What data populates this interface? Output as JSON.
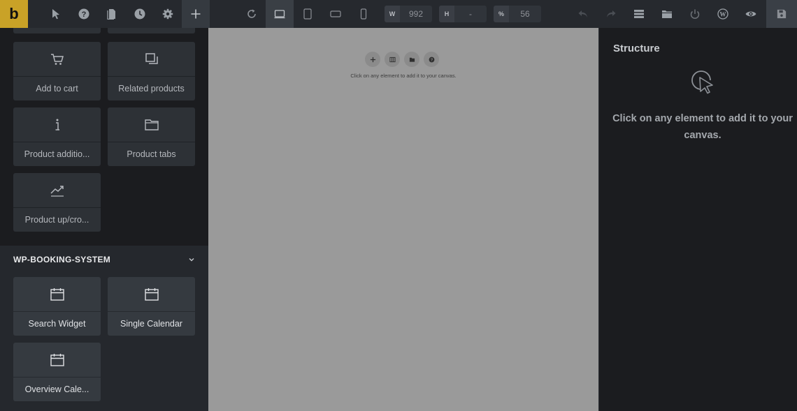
{
  "toolbar": {
    "logo": "b",
    "icons": [
      "cursor-icon",
      "help-icon",
      "pages-icon",
      "history-icon",
      "settings-icon",
      "add-icon",
      "refresh-icon",
      "desktop-icon",
      "tablet-portrait-icon",
      "tablet-landscape-icon",
      "mobile-icon",
      "undo-icon",
      "redo-icon",
      "layers-icon",
      "templates-icon",
      "power-icon",
      "wordpress-icon",
      "preview-icon",
      "save-icon"
    ],
    "width_label": "W",
    "width_value": "992",
    "height_label": "H",
    "height_value": "-",
    "zoom_label": "%",
    "zoom_value": "56"
  },
  "elements_panel": {
    "woocommerce_items": [
      {
        "label": "Add to cart",
        "icon": "cart-icon"
      },
      {
        "label": "Related products",
        "icon": "related-icon"
      },
      {
        "label": "Product additio...",
        "icon": "info-icon"
      },
      {
        "label": "Product tabs",
        "icon": "folder-icon"
      },
      {
        "label": "Product up/cro...",
        "icon": "trend-icon"
      }
    ],
    "booking_section": {
      "title": "WP-BOOKING-SYSTEM",
      "items": [
        {
          "label": "Search Widget",
          "icon": "calendar-icon"
        },
        {
          "label": "Single Calendar",
          "icon": "calendar-icon"
        },
        {
          "label": "Overview Cale...",
          "icon": "calendar-icon"
        }
      ]
    }
  },
  "canvas": {
    "hint": "Click on any element to add it to your canvas.",
    "tools": [
      "add-icon",
      "columns-icon",
      "folder-icon",
      "help-icon"
    ],
    "background": "#9a9a9a"
  },
  "structure": {
    "title": "Structure",
    "hint_line1": "Click on any element to add it to your",
    "hint_line2": "canvas."
  },
  "colors": {
    "accent": "#c9a227",
    "panel": "#1b1c1f",
    "toolbar": "#26292e"
  }
}
